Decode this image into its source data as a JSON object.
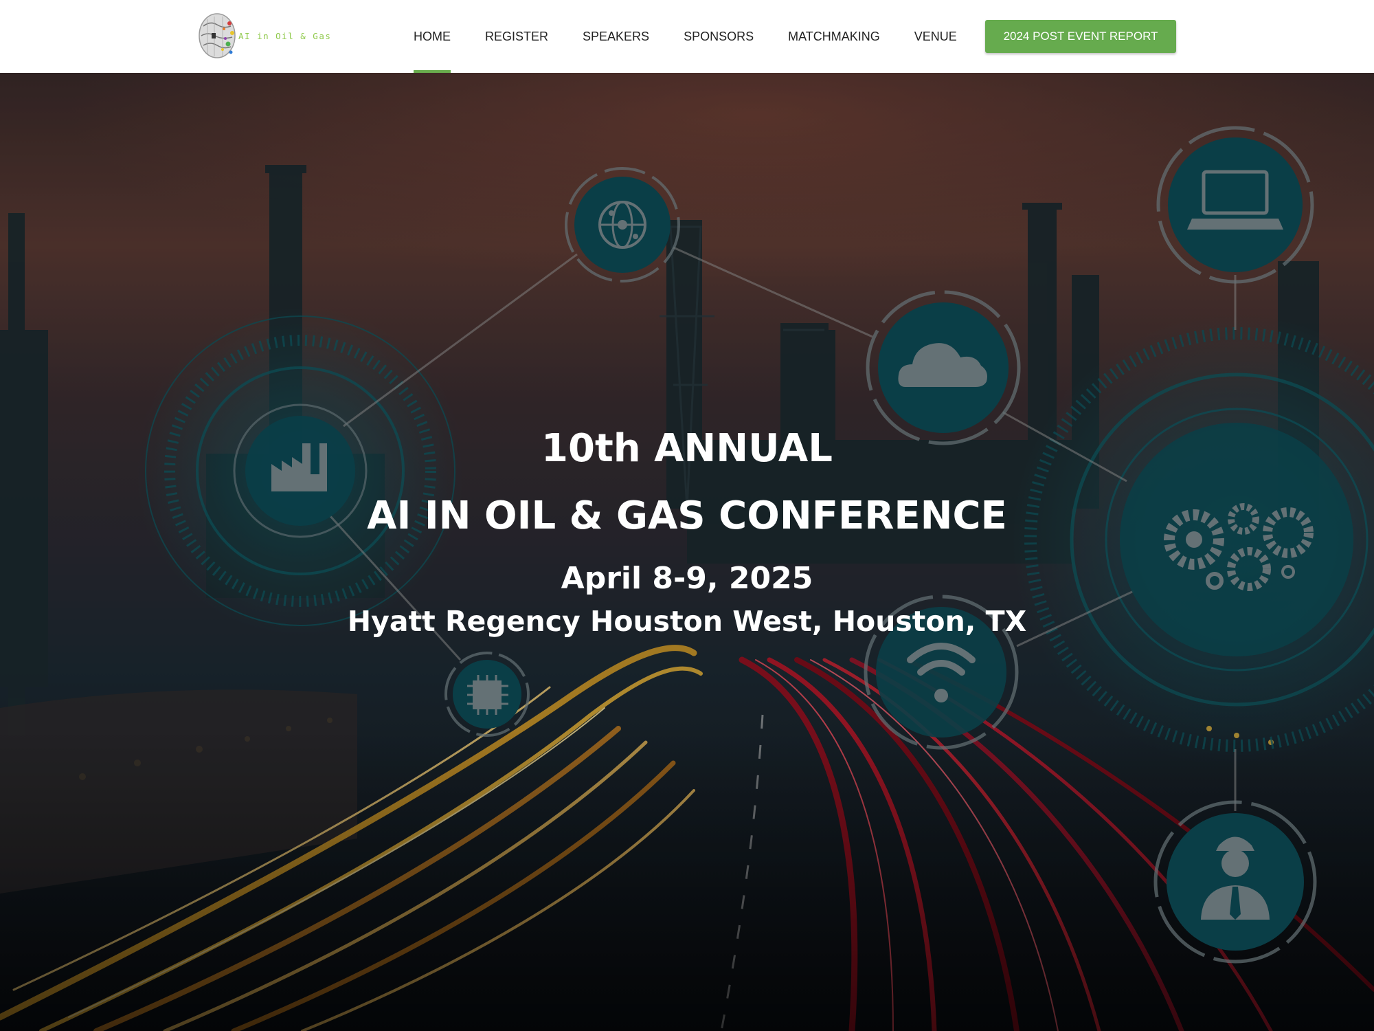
{
  "header": {
    "logo_text": "AI in Oil & Gas",
    "nav": [
      {
        "label": "HOME",
        "active": true
      },
      {
        "label": "REGISTER",
        "active": false
      },
      {
        "label": "SPEAKERS",
        "active": false
      },
      {
        "label": "SPONSORS",
        "active": false
      },
      {
        "label": "MATCHMAKING",
        "active": false
      },
      {
        "label": "VENUE",
        "active": false
      }
    ],
    "cta_label": "2024 POST EVENT REPORT"
  },
  "hero": {
    "line1": "10th ANNUAL",
    "line2": "AI IN OIL & GAS CONFERENCE",
    "date": "April 8-9, 2025",
    "venue": "Hyatt Regency Houston West, Houston, TX",
    "hub_icons": [
      "globe-network-icon",
      "cloud-icon",
      "laptop-icon",
      "factory-icon",
      "gears-icon",
      "chip-icon",
      "wifi-icon",
      "engineer-icon"
    ]
  },
  "colors": {
    "accent_green": "#66ab4e",
    "nav_underline": "#6aad4e",
    "nav_text": "#222222",
    "hero_text": "#ffffff",
    "hub_teal": "#0d4c57"
  }
}
